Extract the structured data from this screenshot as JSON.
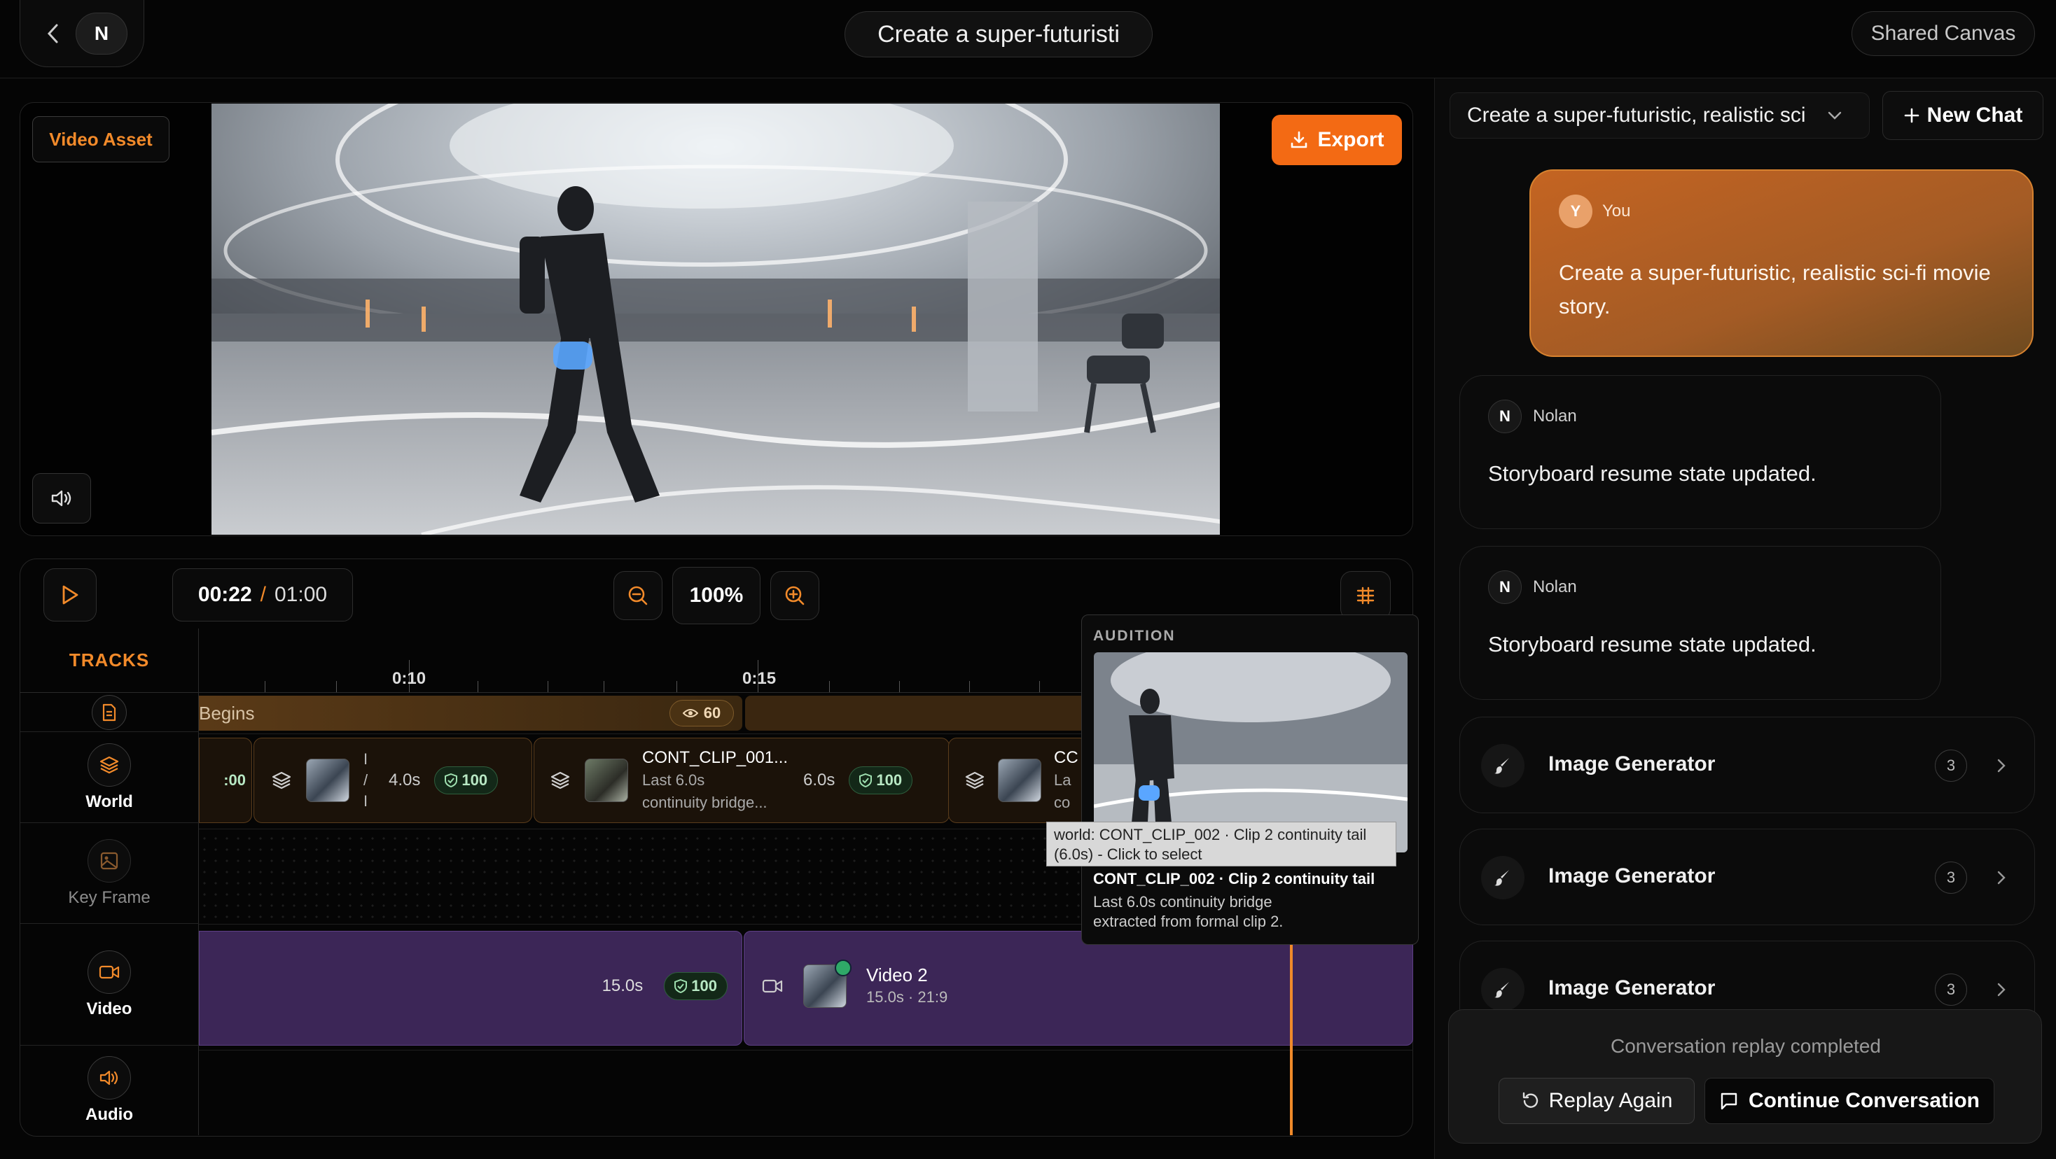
{
  "header": {
    "nav_initial": "N",
    "project_title": "Create a super-futuristi",
    "shared_canvas_label": "Shared Canvas"
  },
  "preview": {
    "asset_tag": "Video Asset",
    "export_label": "Export"
  },
  "timeline": {
    "current_time": "00:22",
    "separator": "/",
    "total_time": "01:00",
    "zoom_level": "100%",
    "tracks_header": "TRACKS",
    "ruler_labels": [
      "0:10",
      "0:15"
    ],
    "tracks": [
      {
        "label": "",
        "icon": "document-icon"
      },
      {
        "label": "World",
        "icon": "layers-icon"
      },
      {
        "label": "Key Frame",
        "icon": "image-icon"
      },
      {
        "label": "Video",
        "icon": "video-camera-icon"
      },
      {
        "label": "Audio",
        "icon": "speaker-icon"
      }
    ],
    "story": {
      "label": "Begins",
      "views": "60"
    },
    "world_clips": [
      {
        "score": "100",
        "prefix": ":00"
      },
      {
        "duration": "4.0s",
        "score": "100",
        "mark1": "I",
        "mark2": "/",
        "mark3": "I"
      },
      {
        "title": "CONT_CLIP_001...",
        "line1": "Last 6.0s",
        "line2": "continuity bridge...",
        "duration": "6.0s",
        "score": "100"
      },
      {
        "title": "CC",
        "line1": "La",
        "line2": "co"
      }
    ],
    "video_clips": [
      {
        "duration": "15.0s",
        "score": "100"
      },
      {
        "title": "Video 2",
        "meta": "15.0s · 21:9"
      }
    ],
    "audition": {
      "header": "AUDITION",
      "tooltip": "world: CONT_CLIP_002 · Clip 2 continuity tail (6.0s) - Click to select",
      "title": "CONT_CLIP_002 · Clip 2 continuity tail",
      "desc1": "Last 6.0s continuity bridge",
      "desc2": "extracted from formal clip 2."
    }
  },
  "chat": {
    "conversation_select": "Create a super-futuristic, realistic sci",
    "new_chat_label": "New Chat",
    "messages": [
      {
        "avatar": "Y",
        "author": "You",
        "text": "Create a super-futuristic, realistic sci-fi movie story."
      },
      {
        "avatar": "N",
        "author": "Nolan",
        "text": "Storyboard resume state updated."
      },
      {
        "avatar": "N",
        "author": "Nolan",
        "text": "Storyboard resume state updated."
      }
    ],
    "tools": [
      {
        "name": "Image Generator",
        "count": "3"
      },
      {
        "name": "Image Generator",
        "count": "3"
      },
      {
        "name": "Image Generator",
        "count": "3"
      }
    ],
    "replay": {
      "status": "Conversation replay completed",
      "replay_label": "Replay Again",
      "continue_label": "Continue Conversation"
    }
  },
  "colors": {
    "accent": "#f36a14",
    "video_track": "#3c2657",
    "story_track": "#5a3a17"
  }
}
